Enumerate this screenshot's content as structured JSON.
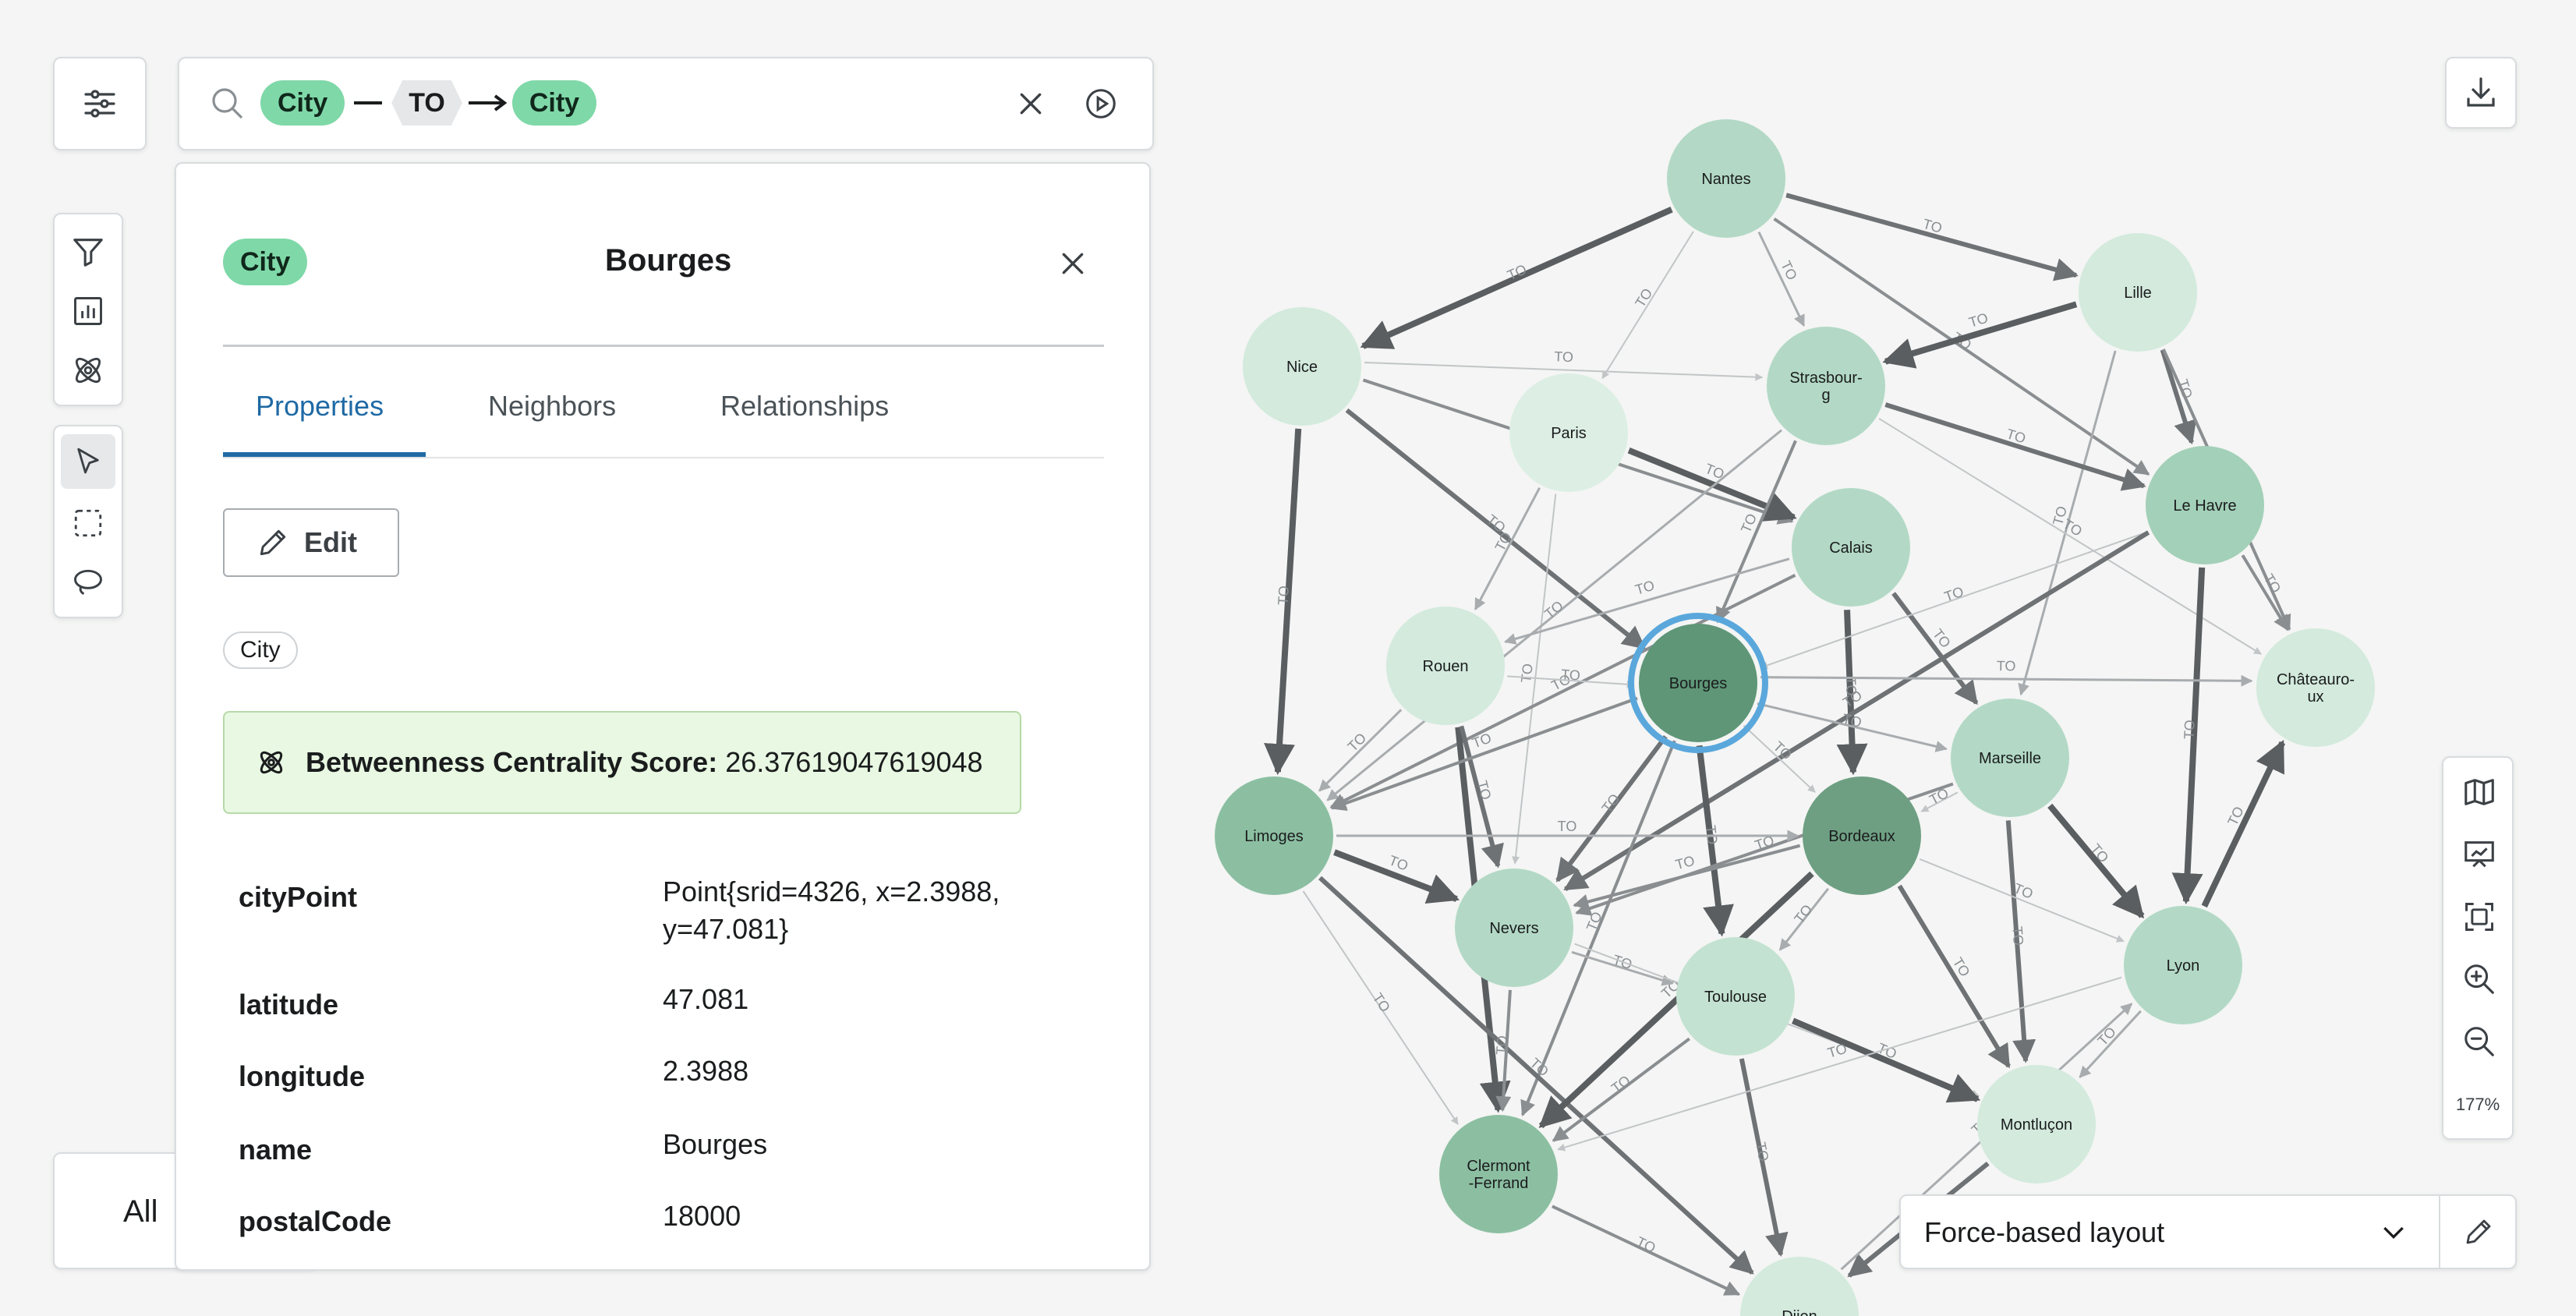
{
  "search": {
    "pattern": {
      "start_label": "City",
      "relationship": "TO",
      "end_label": "City"
    }
  },
  "node_panel": {
    "label_badge": "City",
    "title": "Bourges",
    "tabs": [
      {
        "label": "Properties",
        "active": true
      },
      {
        "label": "Neighbors",
        "active": false
      },
      {
        "label": "Relationships",
        "active": false
      }
    ],
    "edit_label": "Edit",
    "label_chip": "City",
    "centrality": {
      "label": "Betweenness Centrality Score:",
      "value": "26.37619047619048"
    },
    "properties": [
      {
        "key": "cityPoint",
        "value_line1": "Point{srid=4326, x=2.3988,",
        "value_line2": "y=47.081}"
      },
      {
        "key": "latitude",
        "value": "47.081"
      },
      {
        "key": "longitude",
        "value": "2.3988"
      },
      {
        "key": "name",
        "value": "Bourges"
      },
      {
        "key": "postalCode",
        "value": "18000"
      }
    ]
  },
  "bottom_left": {
    "partial_text": "All"
  },
  "layout_select": {
    "value": "Force-based layout"
  },
  "zoom": {
    "level": "177%"
  },
  "graph": {
    "nodes": [
      {
        "name": "Nantes",
        "lines": [
          "Nantes"
        ],
        "shade": "#b3d9c6"
      },
      {
        "name": "Lille",
        "lines": [
          "Lille"
        ],
        "shade": "#d3eadd"
      },
      {
        "name": "Nice",
        "lines": [
          "Nice"
        ],
        "shade": "#d3eadd"
      },
      {
        "name": "Paris",
        "lines": [
          "Paris"
        ],
        "shade": "#ddefe4"
      },
      {
        "name": "Strasbourg",
        "lines": [
          "Strasbour-",
          "g"
        ],
        "shade": "#b3d9c6"
      },
      {
        "name": "Calais",
        "lines": [
          "Calais"
        ],
        "shade": "#b3d9c6"
      },
      {
        "name": "Le Havre",
        "lines": [
          "Le Havre"
        ],
        "shade": "#a3d0b8"
      },
      {
        "name": "Rouen",
        "lines": [
          "Rouen"
        ],
        "shade": "#d3eadd"
      },
      {
        "name": "Bourges",
        "lines": [
          "Bourges"
        ],
        "shade": "#5e9677",
        "selected": true
      },
      {
        "name": "Châteauroux",
        "lines": [
          "Châteauro-",
          "ux"
        ],
        "shade": "#d3eadd"
      },
      {
        "name": "Marseille",
        "lines": [
          "Marseille"
        ],
        "shade": "#b3d9c6"
      },
      {
        "name": "Limoges",
        "lines": [
          "Limoges"
        ],
        "shade": "#8cbfa2"
      },
      {
        "name": "Bordeaux",
        "lines": [
          "Bordeaux"
        ],
        "shade": "#6e9f82"
      },
      {
        "name": "Nevers",
        "lines": [
          "Nevers"
        ],
        "shade": "#b3d9c6"
      },
      {
        "name": "Toulouse",
        "lines": [
          "Toulouse"
        ],
        "shade": "#c4e2d1"
      },
      {
        "name": "Lyon",
        "lines": [
          "Lyon"
        ],
        "shade": "#b3d9c6"
      },
      {
        "name": "Montluçon",
        "lines": [
          "Montluçon"
        ],
        "shade": "#d3eadd"
      },
      {
        "name": "Clermont-Ferrand",
        "lines": [
          "Clermont",
          "-Ferrand"
        ],
        "shade": "#8cbfa2"
      },
      {
        "name": "Dijon",
        "lines": [
          "Dijon"
        ],
        "shade": "#d3eadd"
      }
    ],
    "edge_label": "TO",
    "edges": [
      [
        "Nantes",
        "Nice"
      ],
      [
        "Nantes",
        "Lille"
      ],
      [
        "Nantes",
        "Le Havre"
      ],
      [
        "Nantes",
        "Strasbourg"
      ],
      [
        "Nantes",
        "Paris"
      ],
      [
        "Lille",
        "Strasbourg"
      ],
      [
        "Lille",
        "Le Havre"
      ],
      [
        "Lille",
        "Châteauroux"
      ],
      [
        "Lille",
        "Marseille"
      ],
      [
        "Nice",
        "Strasbourg"
      ],
      [
        "Nice",
        "Limoges"
      ],
      [
        "Nice",
        "Bourges"
      ],
      [
        "Nice",
        "Calais"
      ],
      [
        "Paris",
        "Rouen"
      ],
      [
        "Paris",
        "Nevers"
      ],
      [
        "Paris",
        "Calais"
      ],
      [
        "Strasbourg",
        "Le Havre"
      ],
      [
        "Strasbourg",
        "Bourges"
      ],
      [
        "Strasbourg",
        "Limoges"
      ],
      [
        "Strasbourg",
        "Châteauroux"
      ],
      [
        "Calais",
        "Bordeaux"
      ],
      [
        "Calais",
        "Marseille"
      ],
      [
        "Calais",
        "Limoges"
      ],
      [
        "Calais",
        "Rouen"
      ],
      [
        "Le Havre",
        "Bourges"
      ],
      [
        "Le Havre",
        "Lyon"
      ],
      [
        "Le Havre",
        "Nevers"
      ],
      [
        "Le Havre",
        "Châteauroux"
      ],
      [
        "Rouen",
        "Limoges"
      ],
      [
        "Rouen",
        "Bourges"
      ],
      [
        "Rouen",
        "Clermont-Ferrand"
      ],
      [
        "Rouen",
        "Nevers"
      ],
      [
        "Bourges",
        "Limoges"
      ],
      [
        "Bourges",
        "Châteauroux"
      ],
      [
        "Bourges",
        "Bordeaux"
      ],
      [
        "Bourges",
        "Toulouse"
      ],
      [
        "Bourges",
        "Nevers"
      ],
      [
        "Bourges",
        "Clermont-Ferrand"
      ],
      [
        "Bourges",
        "Marseille"
      ],
      [
        "Marseille",
        "Bordeaux"
      ],
      [
        "Marseille",
        "Lyon"
      ],
      [
        "Marseille",
        "Montluçon"
      ],
      [
        "Marseille",
        "Nevers"
      ],
      [
        "Limoges",
        "Bordeaux"
      ],
      [
        "Limoges",
        "Clermont-Ferrand"
      ],
      [
        "Limoges",
        "Nevers"
      ],
      [
        "Limoges",
        "Dijon"
      ],
      [
        "Bordeaux",
        "Nevers"
      ],
      [
        "Bordeaux",
        "Toulouse"
      ],
      [
        "Bordeaux",
        "Lyon"
      ],
      [
        "Bordeaux",
        "Clermont-Ferrand"
      ],
      [
        "Bordeaux",
        "Montluçon"
      ],
      [
        "Nevers",
        "Clermont-Ferrand"
      ],
      [
        "Nevers",
        "Toulouse"
      ],
      [
        "Nevers",
        "Montluçon"
      ],
      [
        "Toulouse",
        "Montluçon"
      ],
      [
        "Toulouse",
        "Dijon"
      ],
      [
        "Toulouse",
        "Clermont-Ferrand"
      ],
      [
        "Lyon",
        "Montluçon"
      ],
      [
        "Lyon",
        "Clermont-Ferrand"
      ],
      [
        "Lyon",
        "Châteauroux"
      ],
      [
        "Montluçon",
        "Dijon"
      ],
      [
        "Clermont-Ferrand",
        "Dijon"
      ],
      [
        "Dijon",
        "Lyon"
      ]
    ]
  }
}
